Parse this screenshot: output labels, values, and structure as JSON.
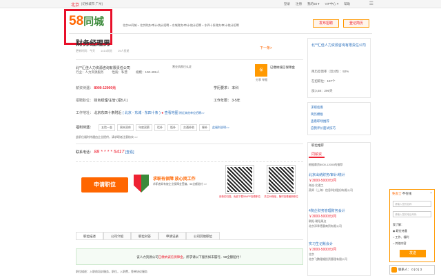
{
  "topbar": {
    "city": "北京",
    "switch": "[切换城市 广州]",
    "links": [
      "登录",
      "注册",
      "我的58 ▾",
      "VIP中心 ▾",
      "帮助"
    ],
    "close": "☰"
  },
  "header": {
    "logo_num": "58",
    "logo_text": "同城",
    "breadcrumb": "北京58同城 > 北京财务/审计/统计招聘 > 东城财务/审计/统计招聘 > 东四十条财务/审计/统计招聘",
    "post_button": "发布招聘",
    "resume_button": "登记简历"
  },
  "job": {
    "title": "财务经理男",
    "meta": [
      "更新时间：今天",
      "1414浏览",
      "19人投递"
    ],
    "next": "下一条>",
    "company": "北**汇佳人力资源咨询有限责任公司",
    "license": "营业执照已认证",
    "company_info": [
      "行业：人力资源服务",
      "性质：私营",
      "规模：100-499人"
    ],
    "badge_text": "已缴纳诚信保障金",
    "share": "分享  举报",
    "salary_label": "薪资待遇：",
    "salary": "8000-12000元",
    "edu_label": "学历要求：",
    "edu": "本科",
    "hire_label": "招聘职位：",
    "hire": "财务经理/主管 (招5人)",
    "exp_label": "工作年限：",
    "exp": "3-5年",
    "addr_label": "工作地址：",
    "addr": "北京东四十条附近",
    "addr_link": "( 北京 - 东城 - 东四十条 )",
    "map": "查看地图",
    "addr_more": "附近其他单位招聘>>",
    "welfare_label": "福利待遇：",
    "tags": [
      "五险一金",
      "周末双休",
      "年底双薪",
      "话补",
      "饭补",
      "交通补助",
      "餐补"
    ],
    "tags_more": "此福利说明>>",
    "welfare_note": "此职位福利待遇由企业提供，请求职者注意核实 >>",
    "phone_label": "联系电话：",
    "phone": "88 * * * * 5417",
    "phone_link": "[查看]",
    "apply": "申请职位",
    "promo_title": "求职有保障  放心找工作",
    "promo_sub": "求职者如有被企业保障金受骗，58全额赔付 >>",
    "qr1_label": "用新的扫描，免费下载58APP查看职位",
    "qr2_label": "关注58微信，随时查看最新职位"
  },
  "tabs": [
    "职位描述",
    "公司介绍",
    "职位对答",
    "申请记录",
    "公司其他职位"
  ],
  "notice": {
    "prefix": "该人力资源公司",
    "highlight": "已缴纳诚信保障金",
    "suffix": "，所求请以下服务如未履行，58全额赔付！"
  },
  "desc_start": "职位描述：入职前培训服务，职位，入职费，签单协议服务",
  "side": {
    "company": "北**汇佳人力资源咨询有限责任公司",
    "lines": [
      "简历反馈率（近2周）：92%",
      "在招职位：197个",
      "加入58：296天"
    ],
    "links": [
      "求职指南",
      "简历模板",
      "查看职场推荐",
      "自我评价面试技巧"
    ],
    "rec_head": "职位推荐",
    "rec_tab": "同薪资",
    "rec_title": "根据薪资8000-12000的推荐",
    "items": [
      {
        "title": "北京出纳财务/审计/统计",
        "salary": "￥3000-5000元/月",
        "company": "海淀·北理工",
        "company2": "燕郊（上海）信息科技股份有限公司"
      },
      {
        "title": "4院企财务管理财务会计",
        "salary": "￥3000-5000元/月",
        "company": "朝阳·朝阳周边",
        "company2": "北京添季德惠商贸有限公司"
      },
      {
        "title": "实习生记账会计",
        "salary": "￥3000-5000元/月",
        "company": "北京",
        "company2": "北京飞鹏理顺投资管理有限公司"
      }
    ]
  },
  "float": {
    "title_o": "免会士",
    "title": "不在线",
    "name_ph": "请输入您的名称",
    "phone_ph": "请输入您的电话号码",
    "intent": "我了解：",
    "options": [
      "职位待遇",
      "工作、福利",
      "其他内容"
    ],
    "submit": "发送",
    "contact": "联系人： 0 | 0 | 3"
  },
  "colors": {
    "accent": "#ff6600",
    "red": "#e8102a",
    "green": "#3a8a3a",
    "link": "#2a6fbc"
  }
}
